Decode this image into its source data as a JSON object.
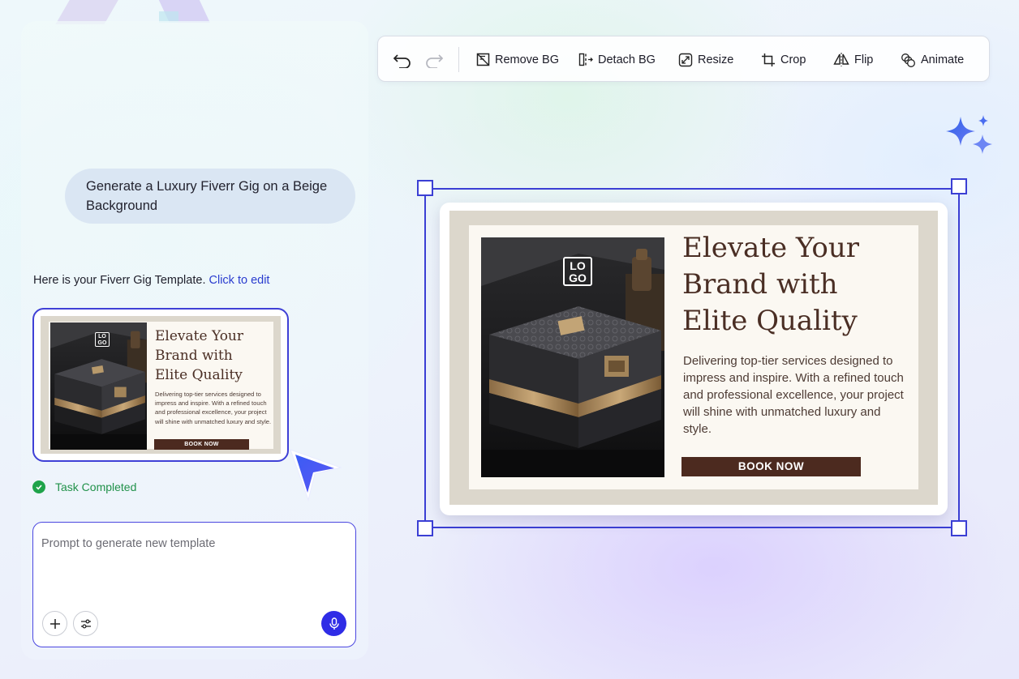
{
  "chat": {
    "user_message": "Generate a Luxury Fiverr Gig on a Beige Background",
    "assistant_reply": "Here is your Fiverr Gig Template.",
    "edit_link": "Click to edit",
    "status": "Task Completed"
  },
  "template": {
    "logo_line1": "LO",
    "logo_line2": "GO",
    "title_line1": "Elevate Your",
    "title_line2": "Brand with",
    "title_line3": "Elite Quality",
    "description": "Delivering top-tier services designed to impress and inspire. With a refined touch and professional excellence, your project will shine with unmatched luxury and style.",
    "button": "BOOK NOW"
  },
  "prompt": {
    "placeholder": "Prompt to generate new template"
  },
  "toolbar": {
    "remove_bg": "Remove BG",
    "detach_bg": "Detach BG",
    "resize": "Resize",
    "crop": "Crop",
    "flip": "Flip",
    "animate": "Animate"
  },
  "colors": {
    "accent": "#3b3fd4",
    "success": "#1fa34a",
    "template_button": "#4c2a1f",
    "template_title": "#4a2e24",
    "template_background": "#dcd7cc"
  }
}
